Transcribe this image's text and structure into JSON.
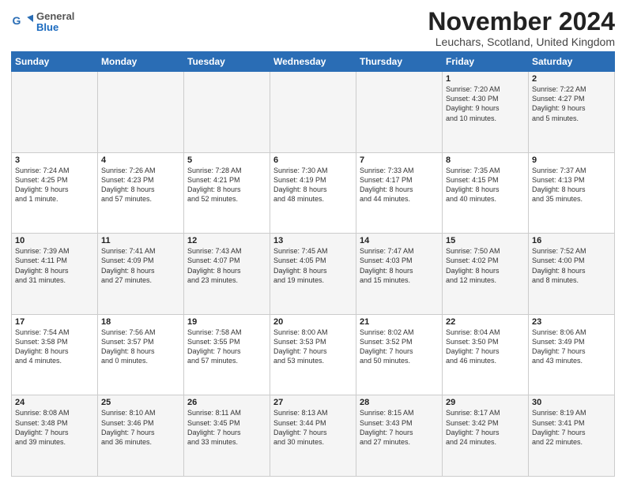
{
  "header": {
    "logo_general": "General",
    "logo_blue": "Blue",
    "title": "November 2024",
    "subtitle": "Leuchars, Scotland, United Kingdom"
  },
  "days_of_week": [
    "Sunday",
    "Monday",
    "Tuesday",
    "Wednesday",
    "Thursday",
    "Friday",
    "Saturday"
  ],
  "weeks": [
    [
      {
        "day": "",
        "info": ""
      },
      {
        "day": "",
        "info": ""
      },
      {
        "day": "",
        "info": ""
      },
      {
        "day": "",
        "info": ""
      },
      {
        "day": "",
        "info": ""
      },
      {
        "day": "1",
        "info": "Sunrise: 7:20 AM\nSunset: 4:30 PM\nDaylight: 9 hours\nand 10 minutes."
      },
      {
        "day": "2",
        "info": "Sunrise: 7:22 AM\nSunset: 4:27 PM\nDaylight: 9 hours\nand 5 minutes."
      }
    ],
    [
      {
        "day": "3",
        "info": "Sunrise: 7:24 AM\nSunset: 4:25 PM\nDaylight: 9 hours\nand 1 minute."
      },
      {
        "day": "4",
        "info": "Sunrise: 7:26 AM\nSunset: 4:23 PM\nDaylight: 8 hours\nand 57 minutes."
      },
      {
        "day": "5",
        "info": "Sunrise: 7:28 AM\nSunset: 4:21 PM\nDaylight: 8 hours\nand 52 minutes."
      },
      {
        "day": "6",
        "info": "Sunrise: 7:30 AM\nSunset: 4:19 PM\nDaylight: 8 hours\nand 48 minutes."
      },
      {
        "day": "7",
        "info": "Sunrise: 7:33 AM\nSunset: 4:17 PM\nDaylight: 8 hours\nand 44 minutes."
      },
      {
        "day": "8",
        "info": "Sunrise: 7:35 AM\nSunset: 4:15 PM\nDaylight: 8 hours\nand 40 minutes."
      },
      {
        "day": "9",
        "info": "Sunrise: 7:37 AM\nSunset: 4:13 PM\nDaylight: 8 hours\nand 35 minutes."
      }
    ],
    [
      {
        "day": "10",
        "info": "Sunrise: 7:39 AM\nSunset: 4:11 PM\nDaylight: 8 hours\nand 31 minutes."
      },
      {
        "day": "11",
        "info": "Sunrise: 7:41 AM\nSunset: 4:09 PM\nDaylight: 8 hours\nand 27 minutes."
      },
      {
        "day": "12",
        "info": "Sunrise: 7:43 AM\nSunset: 4:07 PM\nDaylight: 8 hours\nand 23 minutes."
      },
      {
        "day": "13",
        "info": "Sunrise: 7:45 AM\nSunset: 4:05 PM\nDaylight: 8 hours\nand 19 minutes."
      },
      {
        "day": "14",
        "info": "Sunrise: 7:47 AM\nSunset: 4:03 PM\nDaylight: 8 hours\nand 15 minutes."
      },
      {
        "day": "15",
        "info": "Sunrise: 7:50 AM\nSunset: 4:02 PM\nDaylight: 8 hours\nand 12 minutes."
      },
      {
        "day": "16",
        "info": "Sunrise: 7:52 AM\nSunset: 4:00 PM\nDaylight: 8 hours\nand 8 minutes."
      }
    ],
    [
      {
        "day": "17",
        "info": "Sunrise: 7:54 AM\nSunset: 3:58 PM\nDaylight: 8 hours\nand 4 minutes."
      },
      {
        "day": "18",
        "info": "Sunrise: 7:56 AM\nSunset: 3:57 PM\nDaylight: 8 hours\nand 0 minutes."
      },
      {
        "day": "19",
        "info": "Sunrise: 7:58 AM\nSunset: 3:55 PM\nDaylight: 7 hours\nand 57 minutes."
      },
      {
        "day": "20",
        "info": "Sunrise: 8:00 AM\nSunset: 3:53 PM\nDaylight: 7 hours\nand 53 minutes."
      },
      {
        "day": "21",
        "info": "Sunrise: 8:02 AM\nSunset: 3:52 PM\nDaylight: 7 hours\nand 50 minutes."
      },
      {
        "day": "22",
        "info": "Sunrise: 8:04 AM\nSunset: 3:50 PM\nDaylight: 7 hours\nand 46 minutes."
      },
      {
        "day": "23",
        "info": "Sunrise: 8:06 AM\nSunset: 3:49 PM\nDaylight: 7 hours\nand 43 minutes."
      }
    ],
    [
      {
        "day": "24",
        "info": "Sunrise: 8:08 AM\nSunset: 3:48 PM\nDaylight: 7 hours\nand 39 minutes."
      },
      {
        "day": "25",
        "info": "Sunrise: 8:10 AM\nSunset: 3:46 PM\nDaylight: 7 hours\nand 36 minutes."
      },
      {
        "day": "26",
        "info": "Sunrise: 8:11 AM\nSunset: 3:45 PM\nDaylight: 7 hours\nand 33 minutes."
      },
      {
        "day": "27",
        "info": "Sunrise: 8:13 AM\nSunset: 3:44 PM\nDaylight: 7 hours\nand 30 minutes."
      },
      {
        "day": "28",
        "info": "Sunrise: 8:15 AM\nSunset: 3:43 PM\nDaylight: 7 hours\nand 27 minutes."
      },
      {
        "day": "29",
        "info": "Sunrise: 8:17 AM\nSunset: 3:42 PM\nDaylight: 7 hours\nand 24 minutes."
      },
      {
        "day": "30",
        "info": "Sunrise: 8:19 AM\nSunset: 3:41 PM\nDaylight: 7 hours\nand 22 minutes."
      }
    ]
  ]
}
